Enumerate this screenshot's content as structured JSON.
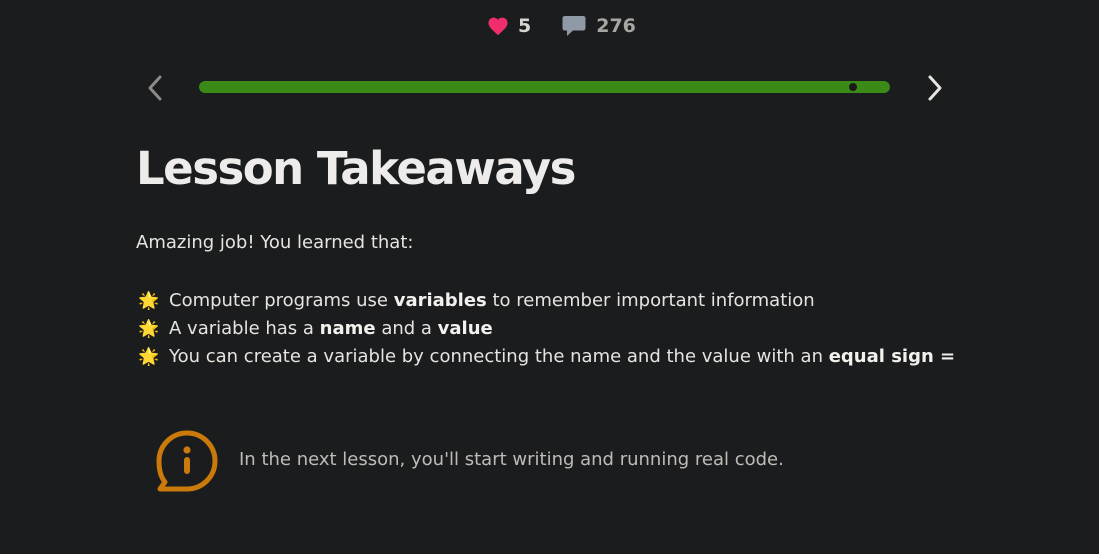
{
  "stats": {
    "likes": "5",
    "comments": "276"
  },
  "progress": {
    "fraction": 1.0
  },
  "lesson": {
    "title": "Lesson Takeaways",
    "intro": "Amazing job! You learned that:",
    "bullet_icon": "sun-emoji",
    "takeaways": [
      {
        "pre": "Computer programs use ",
        "b1": "variables",
        "mid": " to remember important information",
        "b2": "",
        "post": ""
      },
      {
        "pre": "A variable has a ",
        "b1": "name",
        "mid": " and a ",
        "b2": "value",
        "post": ""
      },
      {
        "pre": "You can create a variable by connecting the name and the value with an ",
        "b1": "equal sign =",
        "mid": "",
        "b2": "",
        "post": ""
      }
    ]
  },
  "callout": {
    "icon": "info-chat-icon",
    "text": "In the next lesson, you'll start writing and running real code."
  },
  "colors": {
    "background": "#1b1c1d",
    "progress": "#3b8a18",
    "heart": "#f02d6d",
    "callout_icon": "#c97a0a"
  }
}
